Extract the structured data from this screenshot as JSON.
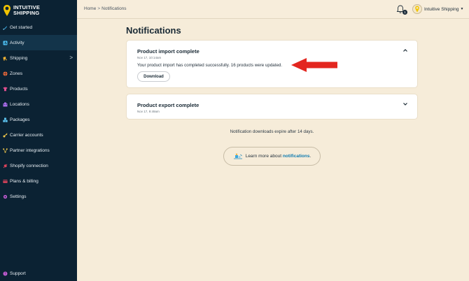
{
  "brand": {
    "line1": "INTUITIVE",
    "line2": "SHIPPING"
  },
  "sidebar": {
    "items": [
      {
        "label": "Get started",
        "icon": "rocket-icon",
        "color": "#3aa7e0"
      },
      {
        "label": "Activity",
        "icon": "activity-icon",
        "color": "#4fc3f7",
        "active": true
      },
      {
        "label": "Shipping",
        "icon": "truck-icon",
        "color": "#f2b233",
        "chevron": ">"
      },
      {
        "label": "Zones",
        "icon": "globe-icon",
        "color": "#f26b3a"
      },
      {
        "label": "Products",
        "icon": "shirt-icon",
        "color": "#e04f8f"
      },
      {
        "label": "Locations",
        "icon": "building-icon",
        "color": "#a76ce8"
      },
      {
        "label": "Packages",
        "icon": "boxes-icon",
        "color": "#5bc0eb"
      },
      {
        "label": "Carrier accounts",
        "icon": "key-icon",
        "color": "#f2c94c"
      },
      {
        "label": "Partner integrations",
        "icon": "network-icon",
        "color": "#f2c94c"
      },
      {
        "label": "Shopify connection",
        "icon": "plug-icon",
        "color": "#e2445c"
      },
      {
        "label": "Plans & billing",
        "icon": "card-icon",
        "color": "#e2445c"
      },
      {
        "label": "Settings",
        "icon": "gear-icon",
        "color": "#c15bd1"
      }
    ],
    "support": "Support"
  },
  "header": {
    "breadcrumb_home": "Home",
    "breadcrumb_sep": ">",
    "breadcrumb_current": "Notifications",
    "notification_count": "1",
    "account_name": "Intuitive Shipping"
  },
  "main": {
    "title": "Notifications",
    "notifications": [
      {
        "title": "Product import complete",
        "date": "Nov 17, 10:14am",
        "message": "Your product import has completed successfully. 16 products were updated.",
        "button": "Download",
        "expanded": true
      },
      {
        "title": "Product export complete",
        "date": "Nov 17, 9:49am",
        "expanded": false
      }
    ],
    "expire_note": "Notification downloads expire after 14 days.",
    "learn_prefix": "Learn more about ",
    "learn_link": "notifications",
    "learn_suffix": "."
  },
  "colors": {
    "sidebar_bg": "#0b2233",
    "page_bg": "#f6ecd9",
    "arrow": "#e3261f",
    "link": "#0f7bb0"
  }
}
